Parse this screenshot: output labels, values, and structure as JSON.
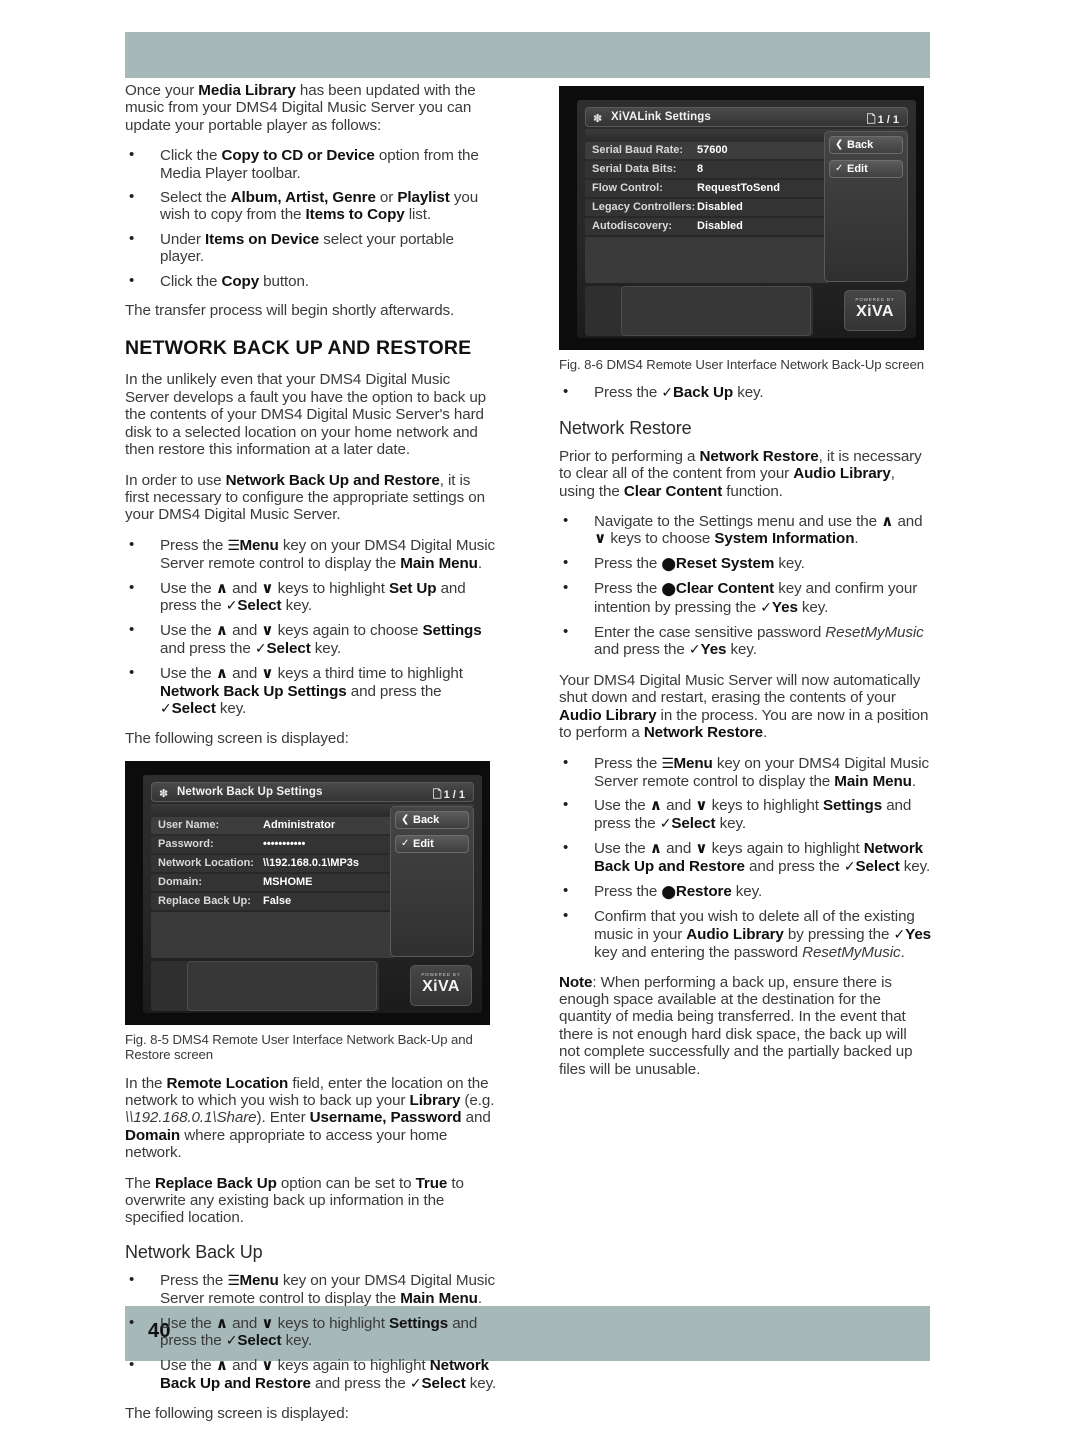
{
  "page": {
    "number": "40"
  },
  "left_column": {
    "intro": {
      "p1_a": "Once your ",
      "p1_b": "Media Library",
      "p1_c": " has been updated with the music from your DMS4 Digital Music Server you can update your portable player as follows:"
    },
    "bullets_copy": [
      {
        "a": "Click the ",
        "b": "Copy to CD or Device",
        "c": " option from the Media Player toolbar."
      },
      {
        "a": "Select the ",
        "b": "Album, Artist, Genre",
        "c": " or ",
        "d": "Playlist",
        "e": " you wish to copy from the ",
        "f": "Items to Copy",
        "g": " list."
      },
      {
        "a": "Under ",
        "b": "Items on Device",
        "c": " select your portable player."
      },
      {
        "a": "Click the ",
        "b": "Copy",
        "c": " button."
      }
    ],
    "transfer_note": "The transfer process will begin shortly afterwards.",
    "section_heading": "NETWORK BACK UP AND RESTORE",
    "p_unlikely": "In the unlikely even that your DMS4 Digital Music Server develops a fault you have the option to back up the contents of your DMS4 Digital Music Server's hard disk to a selected location on your home network and then restore this information at a later date.",
    "p_inorder": {
      "a": "In order to use ",
      "b": "Network Back Up and Restore",
      "c": ", it is first necessary to configure the appropriate settings on your DMS4 Digital Music Server."
    },
    "bullets_configure": [
      {
        "a": "Press the ",
        "icon": "menu-icon",
        "b": "Menu",
        "c": " key on your DMS4 Digital Music Server remote control to display the ",
        "d": "Main Menu",
        "e": "."
      },
      {
        "a": "Use the ",
        "up": "∧",
        "b": " and ",
        "down": "∨",
        "c": " keys to highlight ",
        "d": "Set Up",
        "e": " and press the ",
        "chk": "✓",
        "f": "Select",
        "g": " key."
      },
      {
        "a": "Use the ",
        "up": "∧",
        "b": " and ",
        "down": "∨",
        "c": " keys again to choose ",
        "d": "Settings",
        "e": " and press the ",
        "chk": "✓",
        "f": "Select",
        "g": " key."
      },
      {
        "a": "Use the ",
        "up": "∧",
        "b": " and ",
        "down": "∨",
        "c": " keys a third time to highlight ",
        "d": "Network Back Up Settings",
        "e": " and press the ",
        "chk": "✓",
        "f": "Select",
        "g": " key."
      }
    ],
    "following_screen_1": "The following screen is displayed:",
    "figure_85": {
      "title": "Network Back Up Settings",
      "page_indicator": "1 / 1",
      "rows": [
        {
          "key": "User Name:",
          "value": "Administrator"
        },
        {
          "key": "Password:",
          "value": "•••••••••••"
        },
        {
          "key": "Network Location:",
          "value": "\\\\192.168.0.1\\MP3s"
        },
        {
          "key": "Domain:",
          "value": "MSHOME"
        },
        {
          "key": "Replace Back Up:",
          "value": "False"
        }
      ],
      "buttons": [
        {
          "icon": "❮",
          "label": "Back"
        },
        {
          "icon": "✓",
          "label": "Edit"
        }
      ],
      "brand_powered": "POWERED BY",
      "brand_logo": "XiVA",
      "caption": "Fig. 8-5  DMS4 Remote User Interface Network Back-Up and Restore screen"
    },
    "p_remote_location": {
      "a": "In the ",
      "b": "Remote Location",
      "c": " field, enter the location on the network to which you wish to back up your ",
      "d": "Library",
      "e": " (e.g. ",
      "f": "\\\\192.168.0.1\\Share",
      "g": ").  Enter ",
      "h": "Username, Password",
      "i": " and ",
      "j": "Domain",
      "k": " where appropriate to access your home network."
    },
    "p_replace": {
      "a": "The ",
      "b": "Replace Back Up",
      "c": " option can be set to ",
      "d": "True",
      "e": " to overwrite any existing back up information in the specified location."
    },
    "sub_heading_backup": "Network Back Up",
    "bullets_backup": [
      {
        "a": "Press the ",
        "icon": "menu-icon",
        "b": "Menu",
        "c": " key on your DMS4 Digital Music Server remote control to display the ",
        "d": "Main Menu",
        "e": "."
      },
      {
        "a": "Use the ",
        "up": "∧",
        "b": " and ",
        "down": "∨",
        "c": " keys to highlight ",
        "d": "Settings",
        "e": " and press the ",
        "chk": "✓",
        "f": "Select",
        "g": " key."
      },
      {
        "a": "Use the ",
        "up": "∧",
        "b": " and ",
        "down": "∨",
        "c": " keys again to highlight ",
        "d": "Network Back Up and Restore",
        "e": " and press the ",
        "chk": "✓",
        "f": "Select",
        "g": " key."
      }
    ],
    "following_screen_2": "The following screen is displayed:"
  },
  "right_column": {
    "figure_86": {
      "title": "XiVALink Settings",
      "page_indicator": "1 / 1",
      "rows": [
        {
          "key": "Serial Baud Rate:",
          "value": "57600"
        },
        {
          "key": "Serial Data Bits:",
          "value": "8"
        },
        {
          "key": "Flow Control:",
          "value": "RequestToSend"
        },
        {
          "key": "Legacy Controllers:",
          "value": "Disabled"
        },
        {
          "key": "Autodiscovery:",
          "value": "Disabled"
        }
      ],
      "buttons": [
        {
          "icon": "❮",
          "label": "Back"
        },
        {
          "icon": "✓",
          "label": "Edit"
        }
      ],
      "brand_powered": "POWERED BY",
      "brand_logo": "XiVA",
      "caption": "Fig. 8-6  DMS4 Remote User Interface Network Back-Up screen"
    },
    "bullet_backup_key": {
      "a": "Press the ",
      "chk": "✓",
      "b": "Back Up",
      "c": " key."
    },
    "sub_heading_restore": "Network Restore",
    "p_prior": {
      "a": "Prior to performing a ",
      "b": "Network Restore",
      "c": ", it is necessary to clear all of the content from your ",
      "d": "Audio Library",
      "e": ", using the ",
      "f": "Clear Content",
      "g": " function."
    },
    "bullets_clear": [
      {
        "a": "Navigate to the Settings menu and use the ",
        "up": "∧",
        "b": " and ",
        "down": "∨",
        "c": " keys to choose ",
        "d": "System Information",
        "e": "."
      },
      {
        "a": "Press the ",
        "circ": "⬤",
        "b": "Reset System",
        "c": " key."
      },
      {
        "a": "Press the ",
        "circ": "⬤",
        "b": "Clear Content",
        "c": " key and confirm your intention by pressing the ",
        "chk": "✓",
        "d": "Yes",
        "e": " key."
      },
      {
        "a": "Enter the case sensitive password ",
        "ital": "ResetMyMusic",
        "b": " and press the ",
        "chk": "✓",
        "c": "Yes",
        "d": " key."
      }
    ],
    "p_shutdown": {
      "a": "Your DMS4 Digital Music Server will now automatically shut down and restart, erasing the contents of your ",
      "b": "Audio Library",
      "c": " in the process.  You are now in a position to perform a ",
      "d": "Network Restore",
      "e": "."
    },
    "bullets_restore": [
      {
        "a": "Press the ",
        "icon": "menu-icon",
        "b": "Menu",
        "c": " key on your DMS4 Digital Music Server remote control to display the ",
        "d": "Main Menu",
        "e": "."
      },
      {
        "a": "Use the ",
        "up": "∧",
        "b": " and ",
        "down": "∨",
        "c": " keys to highlight ",
        "d": "Settings",
        "e": " and press the ",
        "chk": "✓",
        "f": "Select",
        "g": " key."
      },
      {
        "a": "Use the ",
        "up": "∧",
        "b": " and ",
        "down": "∨",
        "c": " keys again to highlight ",
        "d": "Network Back Up and Restore",
        "e": " and press the ",
        "chk": "✓",
        "f": "Select",
        "g": " key."
      },
      {
        "a": "Press the ",
        "circ": "⬤",
        "b": "Restore",
        "c": " key."
      },
      {
        "a": "Confirm that you wish to delete all of the existing music in your ",
        "b": "Audio Library",
        "c": " by pressing the ",
        "chk": "✓",
        "d": "Yes",
        "e": " key and entering the password ",
        "ital": "ResetMyMusic",
        "f": "."
      }
    ],
    "note": {
      "label": "Note",
      "text": ": When performing a back up, ensure there is enough space available at the destination for the quantity of media being transferred.  In the event that there is not enough hard disk space, the back up will not complete successfully and the partially backed up files will be unusable."
    }
  },
  "colors": {
    "band": "#a7b8b9",
    "body_text": "#3a3a3a",
    "heading_text": "#111111"
  }
}
